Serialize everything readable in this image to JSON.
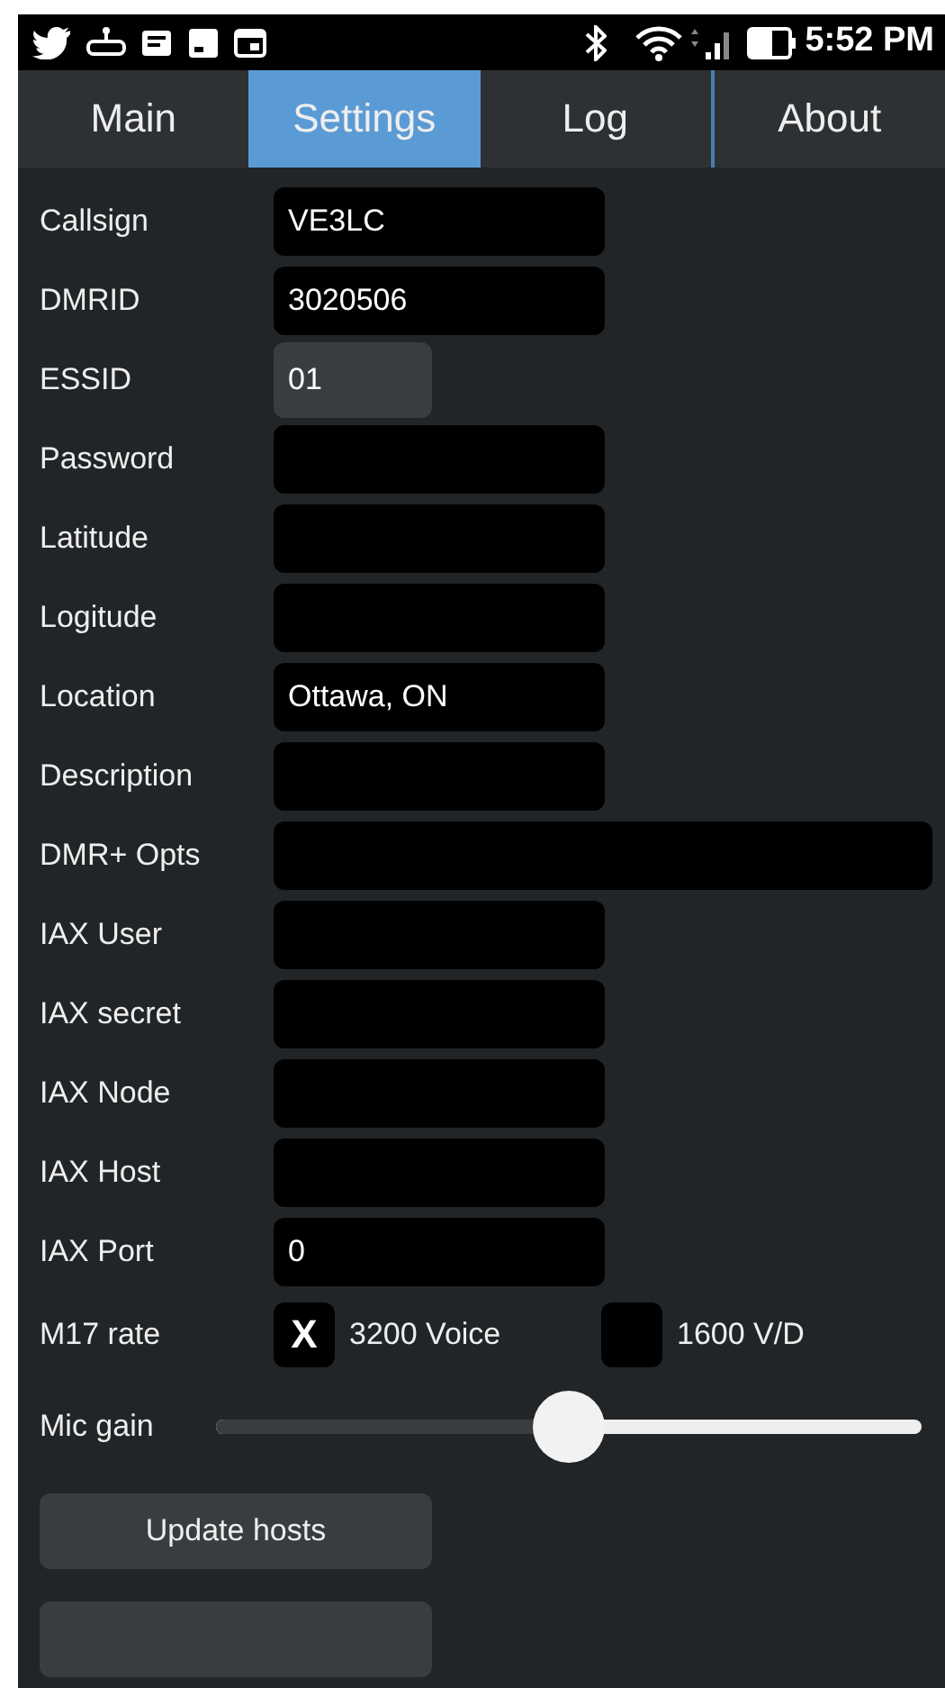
{
  "status_bar": {
    "time": "5:52 PM"
  },
  "tabs": [
    {
      "label": "Main",
      "selected": false
    },
    {
      "label": "Settings",
      "selected": true
    },
    {
      "label": "Log",
      "selected": false
    },
    {
      "label": "About",
      "selected": false
    }
  ],
  "fields": [
    {
      "label": "Callsign",
      "value": "VE3LC",
      "kind": "text"
    },
    {
      "label": "DMRID",
      "value": "3020506",
      "kind": "text"
    },
    {
      "label": "ESSID",
      "value": "01",
      "kind": "short"
    },
    {
      "label": "Password",
      "kind": "text"
    },
    {
      "label": "Latitude",
      "kind": "text"
    },
    {
      "label": "Logitude",
      "kind": "text"
    },
    {
      "label": "Location",
      "value": "Ottawa, ON",
      "kind": "text"
    },
    {
      "label": "Description",
      "kind": "text"
    },
    {
      "label": "DMR+ Opts",
      "kind": "wide"
    },
    {
      "label": "IAX User",
      "kind": "text"
    },
    {
      "label": "IAX secret",
      "kind": "text"
    },
    {
      "label": "IAX Node",
      "kind": "text"
    },
    {
      "label": "IAX Host",
      "kind": "text"
    },
    {
      "label": "IAX Port",
      "value": "0",
      "kind": "text"
    }
  ],
  "m17_rate": {
    "label": "M17 rate",
    "check_mark": "X",
    "options": [
      {
        "label": "3200 Voice",
        "checked": true
      },
      {
        "label": "1600 V/D",
        "checked": false
      }
    ]
  },
  "mic_gain": {
    "label": "Mic gain",
    "level": 0.5
  },
  "buttons": [
    {
      "kind": "labeled",
      "label": "Update hosts"
    },
    {
      "kind": "partial"
    }
  ]
}
